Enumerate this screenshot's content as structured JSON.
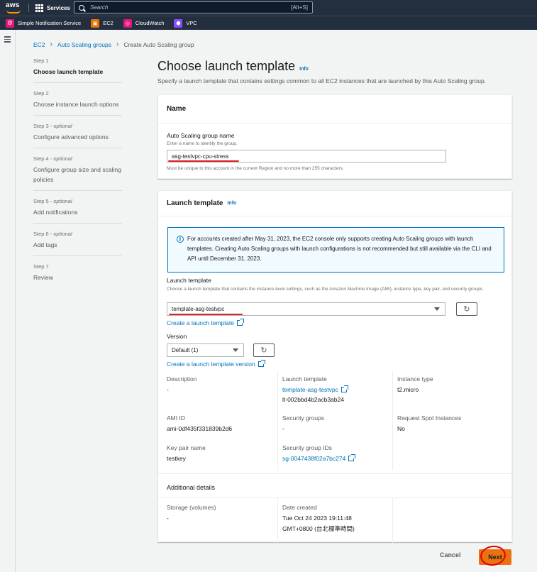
{
  "topnav": {
    "logo": "aws",
    "services_label": "Services",
    "search_placeholder": "Search",
    "search_shortcut": "[Alt+S]"
  },
  "favorites": [
    {
      "label": "Simple Notification Service",
      "color": "#e7157b",
      "icon": "sns-icon",
      "glyph": "@"
    },
    {
      "label": "EC2",
      "color": "#ed7100",
      "icon": "ec2-icon",
      "glyph": "▣"
    },
    {
      "label": "CloudWatch",
      "color": "#e7157b",
      "icon": "cloudwatch-icon",
      "glyph": "◎"
    },
    {
      "label": "VPC",
      "color": "#8c4fff",
      "icon": "vpc-icon",
      "glyph": "⬢"
    }
  ],
  "breadcrumb": {
    "items": [
      "EC2",
      "Auto Scaling groups"
    ],
    "current": "Create Auto Scaling group"
  },
  "steps": [
    {
      "num": "Step 1",
      "optional": "",
      "label": "Choose launch template",
      "active": true
    },
    {
      "num": "Step 2",
      "optional": "",
      "label": "Choose instance launch options",
      "active": false
    },
    {
      "num": "Step 3",
      "optional": "optional",
      "label": "Configure advanced options",
      "active": false
    },
    {
      "num": "Step 4",
      "optional": "optional",
      "label": "Configure group size and scaling policies",
      "active": false
    },
    {
      "num": "Step 5",
      "optional": "optional",
      "label": "Add notifications",
      "active": false
    },
    {
      "num": "Step 6",
      "optional": "optional",
      "label": "Add tags",
      "active": false
    },
    {
      "num": "Step 7",
      "optional": "",
      "label": "Review",
      "active": false
    }
  ],
  "page": {
    "title": "Choose launch template",
    "info": "Info",
    "description": "Specify a launch template that contains settings common to all EC2 instances that are launched by this Auto Scaling group."
  },
  "name_card": {
    "header": "Name",
    "field_label": "Auto Scaling group name",
    "field_help": "Enter a name to identify the group.",
    "field_value": "asg-testvpc-cpu-stress",
    "constraint": "Must be unique to this account in the current Region and no more than 255 characters."
  },
  "lt_card": {
    "header": "Launch template",
    "info": "Info",
    "alert": "For accounts created after May 31, 2023, the EC2 console only supports creating Auto Scaling groups with launch templates. Creating Auto Scaling groups with launch configurations is not recommended but still available via the CLI and API until December 31, 2023.",
    "field_label": "Launch template",
    "field_help": "Choose a launch template that contains the instance-level settings, such as the Amazon Machine Image (AMI), instance type, key pair, and security groups.",
    "selected": "template-asg-testvpc",
    "create_link": "Create a launch template",
    "version_label": "Version",
    "version_selected": "Default (1)",
    "create_version_link": "Create a launch template version",
    "details": {
      "description_label": "Description",
      "description_value": "-",
      "launch_template_label": "Launch template",
      "launch_template_link": "template-asg-testvpc",
      "launch_template_id": "lt-002bbd4b2acb3ab24",
      "instance_type_label": "Instance type",
      "instance_type_value": "t2.micro",
      "ami_label": "AMI ID",
      "ami_value": "ami-0df435f331839b2d6",
      "sg_label": "Security groups",
      "sg_value": "-",
      "spot_label": "Request Spot Instances",
      "spot_value": "No",
      "keypair_label": "Key pair name",
      "keypair_value": "testkey",
      "sgid_label": "Security group IDs",
      "sgid_link": "sg-0047438f02a7bc274"
    },
    "additional_header": "Additional details",
    "storage_label": "Storage (volumes)",
    "storage_value": "-",
    "date_label": "Date created",
    "date_value_1": "Tue Oct 24 2023 19:11:48",
    "date_value_2": "GMT+0800 (台北標準時間)"
  },
  "footer": {
    "cancel": "Cancel",
    "next": "Next"
  }
}
